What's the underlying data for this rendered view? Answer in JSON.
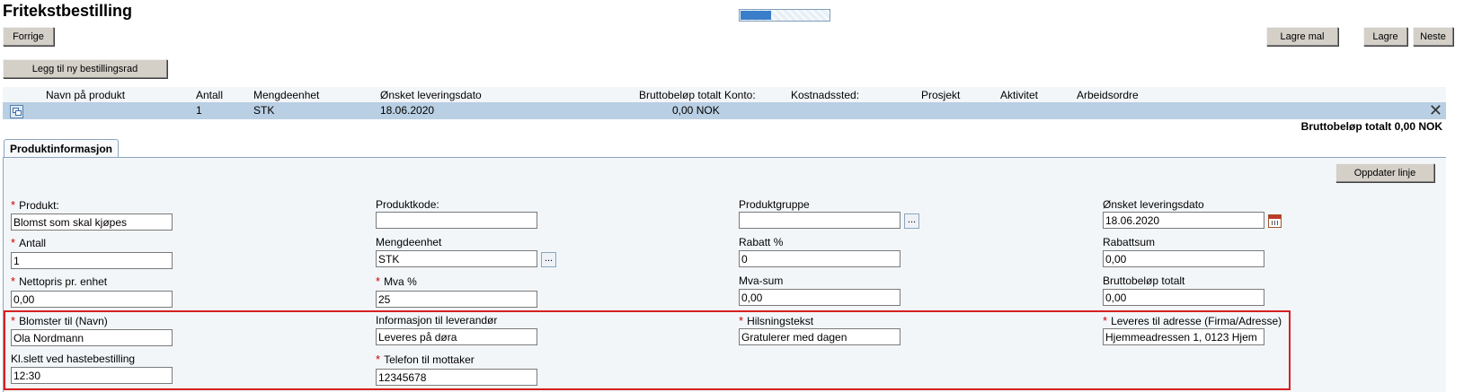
{
  "page": {
    "title": "Fritekstbestilling",
    "progress_pct": 35
  },
  "toolbar": {
    "prev_label": "Forrige",
    "save_template_label": "Lagre mal",
    "save_label": "Lagre",
    "next_label": "Neste",
    "add_row_label": "Legg til ny bestillingsrad"
  },
  "grid": {
    "headers": {
      "name": "Navn på produkt",
      "qty": "Antall",
      "unit": "Mengdeenhet",
      "date": "Ønsket leveringsdato",
      "gross": "Bruttobeløp totalt",
      "account": "Konto:",
      "cost_center": "Kostnadssted:",
      "project": "Prosjekt",
      "activity": "Aktivitet",
      "work_order": "Arbeidsordre"
    },
    "row": {
      "qty": "1",
      "unit": "STK",
      "date": "18.06.2020",
      "gross": "0,00 NOK"
    },
    "total_label": "Bruttobeløp totalt 0,00 NOK"
  },
  "tab": {
    "label": "Produktinformasjon"
  },
  "form": {
    "update_label": "Oppdater linje",
    "produkt": {
      "label": "Produkt:",
      "value": "Blomst som skal kjøpes"
    },
    "produktkode": {
      "label": "Produktkode:",
      "value": ""
    },
    "produktgruppe": {
      "label": "Produktgruppe",
      "value": ""
    },
    "onsket_dato": {
      "label": "Ønsket leveringsdato",
      "value": "18.06.2020"
    },
    "antall": {
      "label": "Antall",
      "value": "1"
    },
    "mengdeenhet": {
      "label": "Mengdeenhet",
      "value": "STK"
    },
    "rabatt_pct": {
      "label": "Rabatt %",
      "value": "0"
    },
    "rabattsum": {
      "label": "Rabattsum",
      "value": "0,00"
    },
    "nettopris": {
      "label": "Nettopris pr. enhet",
      "value": "0,00"
    },
    "mva_pct": {
      "label": "Mva %",
      "value": "25"
    },
    "mva_sum": {
      "label": "Mva-sum",
      "value": "0,00"
    },
    "brutto": {
      "label": "Bruttobeløp totalt",
      "value": "0,00"
    },
    "blomster_til": {
      "label": "Blomster til (Navn)",
      "value": "Ola Nordmann"
    },
    "info_leverandor": {
      "label": "Informasjon til leverandør",
      "value": "Leveres på døra"
    },
    "hilsning": {
      "label": "Hilsningstekst",
      "value": "Gratulerer med dagen"
    },
    "leveres_adresse": {
      "label": "Leveres til adresse (Firma/Adresse)",
      "value": "Hjemmeadressen 1, 0123 Hjem"
    },
    "klslett": {
      "label": "Kl.slett ved hastebestilling",
      "value": "12:30"
    },
    "telefon": {
      "label": "Telefon til mottaker",
      "value": "12345678"
    },
    "dots_label": "..."
  },
  "icons": {
    "row": "copy-rows-icon",
    "close": "close-icon",
    "calendar": "calendar-icon"
  },
  "colors": {
    "highlight": "#d62020",
    "row_bg": "#b9cfe3",
    "required": "#cc0000",
    "progress": "#3a7dc9"
  }
}
